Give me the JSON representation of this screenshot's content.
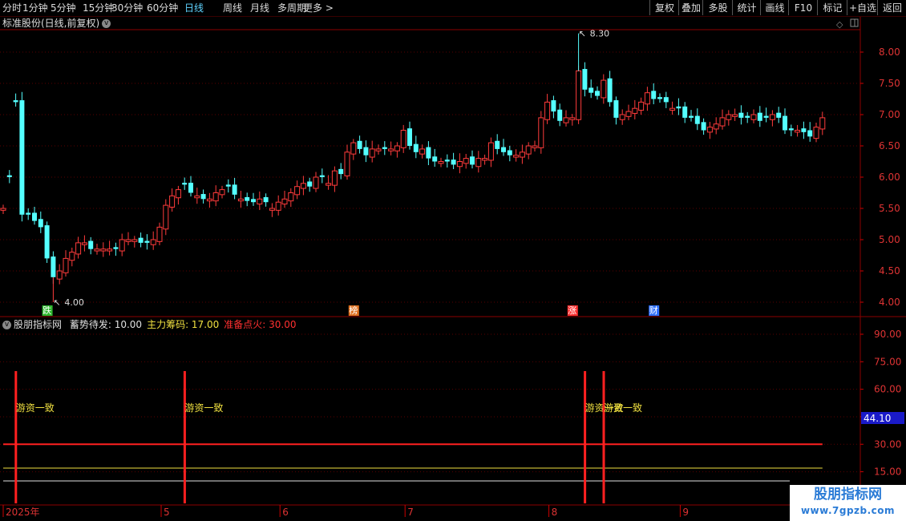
{
  "toolbar": {
    "periods": [
      "分时",
      "1分钟",
      "5分钟",
      "15分钟",
      "30分钟",
      "60分钟",
      "日线",
      "周线",
      "月线",
      "多周期",
      "更多 >"
    ],
    "active_period": "日线",
    "right_buttons": [
      "复权",
      "叠加",
      "多股",
      "统计",
      "画线",
      "F10",
      "标记",
      "+自选",
      "返回"
    ]
  },
  "chart_title": "标准股份(日线,前复权)",
  "indicator": {
    "name": "股朋指标网",
    "params": [
      {
        "label": "蓄势待发:",
        "value": "10.00",
        "color": "#e0e0e0"
      },
      {
        "label": "主力筹码:",
        "value": "17.00",
        "color": "#f0e040"
      },
      {
        "label": "准备点火:",
        "value": "30.00",
        "color": "#ff3030"
      }
    ],
    "signal_label": "游资一致",
    "current_value": "44.10",
    "signals_at_candle": [
      1,
      28,
      92,
      95
    ]
  },
  "price_axis": {
    "min": 4.0,
    "max": 8.0,
    "ticks": [
      "8.00",
      "7.50",
      "7.00",
      "6.50",
      "6.00",
      "5.50",
      "5.00",
      "4.50",
      "4.00"
    ]
  },
  "indicator_axis": {
    "ticks": [
      "90.00",
      "75.00",
      "60.00",
      "45.00",
      "30.00",
      "15.00"
    ]
  },
  "annotations": {
    "high": "8.30",
    "low": "4.00"
  },
  "event_markers": [
    {
      "label": "跌",
      "candle": 7,
      "color": "#2eb82e"
    },
    {
      "label": "榜",
      "candle": 56,
      "color": "#e07020"
    },
    {
      "label": "涨",
      "candle": 91,
      "color": "#ff3030"
    },
    {
      "label": "财",
      "candle": 104,
      "color": "#3070ff"
    }
  ],
  "date_axis": [
    {
      "label": "2025年",
      "candle": 0
    },
    {
      "label": "5",
      "candle": 25
    },
    {
      "label": "6",
      "candle": 44
    },
    {
      "label": "7",
      "candle": 64
    },
    {
      "label": "8",
      "candle": 87
    },
    {
      "label": "9",
      "candle": 108
    }
  ],
  "watermark": {
    "title": "股朋指标网",
    "url": "www.7gpzb.com"
  },
  "chart_data": {
    "type": "candlestick",
    "close_price": [
      5.5,
      6.0,
      7.2,
      5.4,
      5.4,
      5.3,
      5.2,
      4.7,
      4.4,
      4.5,
      4.7,
      4.8,
      4.95,
      4.95,
      4.85,
      4.85,
      4.85,
      4.85,
      4.85,
      5.0,
      5.0,
      5.0,
      4.95,
      4.95,
      5.0,
      5.2,
      5.55,
      5.7,
      5.8,
      5.88,
      5.75,
      5.7,
      5.65,
      5.65,
      5.75,
      5.8,
      5.85,
      5.72,
      5.65,
      5.62,
      5.6,
      5.65,
      5.6,
      5.5,
      5.6,
      5.65,
      5.75,
      5.85,
      5.9,
      5.85,
      6.0,
      6.0,
      5.9,
      6.1,
      6.05,
      6.4,
      6.55,
      6.45,
      6.35,
      6.45,
      6.45,
      6.45,
      6.45,
      6.5,
      6.75,
      6.5,
      6.4,
      6.45,
      6.3,
      6.25,
      6.25,
      6.25,
      6.2,
      6.25,
      6.3,
      6.2,
      6.3,
      6.3,
      6.55,
      6.45,
      6.4,
      6.35,
      6.35,
      6.4,
      6.5,
      6.5,
      6.95,
      7.2,
      7.05,
      6.9,
      6.95,
      6.95,
      7.7,
      7.4,
      7.35,
      7.3,
      7.55,
      7.2,
      6.95,
      7.0,
      7.05,
      7.1,
      7.2,
      7.35,
      7.25,
      7.25,
      7.2,
      7.1,
      7.1,
      6.95,
      6.95,
      6.85,
      6.75,
      6.8,
      6.85,
      6.95,
      7.0,
      7.0,
      6.95,
      6.95,
      7.0,
      6.9,
      6.95,
      7.0,
      6.95,
      6.75,
      6.75,
      6.75,
      6.72,
      6.65,
      6.8,
      6.95
    ],
    "bullish": [
      1,
      0,
      0,
      0,
      0,
      0,
      0,
      0,
      0,
      1,
      1,
      1,
      1,
      1,
      0,
      1,
      1,
      1,
      0,
      1,
      1,
      1,
      0,
      0,
      1,
      1,
      1,
      1,
      1,
      0,
      0,
      1,
      0,
      1,
      1,
      1,
      0,
      0,
      1,
      0,
      0,
      1,
      0,
      1,
      1,
      1,
      1,
      1,
      1,
      0,
      1,
      0,
      1,
      1,
      0,
      1,
      1,
      0,
      0,
      1,
      1,
      0,
      1,
      1,
      1,
      0,
      0,
      1,
      0,
      0,
      1,
      0,
      0,
      1,
      1,
      0,
      1,
      1,
      1,
      0,
      0,
      0,
      1,
      1,
      1,
      1,
      1,
      1,
      0,
      0,
      1,
      1,
      1,
      0,
      0,
      0,
      1,
      0,
      0,
      1,
      1,
      1,
      1,
      1,
      0,
      0,
      0,
      1,
      0,
      0,
      0,
      0,
      0,
      1,
      1,
      1,
      1,
      1,
      0,
      0,
      1,
      0,
      0,
      1,
      0,
      0,
      0,
      1,
      0,
      0,
      1,
      1
    ],
    "ylim": [
      4.0,
      8.0
    ]
  }
}
